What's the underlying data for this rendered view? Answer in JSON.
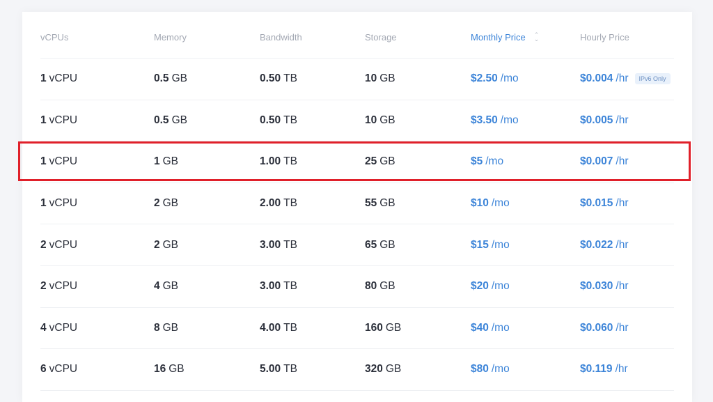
{
  "table": {
    "columns": [
      {
        "label": "vCPUs",
        "sorted": false
      },
      {
        "label": "Memory",
        "sorted": false
      },
      {
        "label": "Bandwidth",
        "sorted": false
      },
      {
        "label": "Storage",
        "sorted": false
      },
      {
        "label": "Monthly Price",
        "sorted": true,
        "sort_icon": "sort-up-down-icon"
      },
      {
        "label": "Hourly Price",
        "sorted": false
      }
    ],
    "rows": [
      {
        "vcpu": {
          "n": "1",
          "u": "vCPU"
        },
        "memory": {
          "n": "0.5",
          "u": "GB"
        },
        "bandwidth": {
          "n": "0.50",
          "u": "TB"
        },
        "storage": {
          "n": "10",
          "u": "GB"
        },
        "monthly": {
          "n": "$2.50",
          "u": "/mo"
        },
        "hourly": {
          "n": "$0.004",
          "u": "/hr"
        },
        "badge": "IPv6 Only",
        "highlighted": false
      },
      {
        "vcpu": {
          "n": "1",
          "u": "vCPU"
        },
        "memory": {
          "n": "0.5",
          "u": "GB"
        },
        "bandwidth": {
          "n": "0.50",
          "u": "TB"
        },
        "storage": {
          "n": "10",
          "u": "GB"
        },
        "monthly": {
          "n": "$3.50",
          "u": "/mo"
        },
        "hourly": {
          "n": "$0.005",
          "u": "/hr"
        },
        "badge": null,
        "highlighted": false
      },
      {
        "vcpu": {
          "n": "1",
          "u": "vCPU"
        },
        "memory": {
          "n": "1",
          "u": "GB"
        },
        "bandwidth": {
          "n": "1.00",
          "u": "TB"
        },
        "storage": {
          "n": "25",
          "u": "GB"
        },
        "monthly": {
          "n": "$5",
          "u": "/mo"
        },
        "hourly": {
          "n": "$0.007",
          "u": "/hr"
        },
        "badge": null,
        "highlighted": true
      },
      {
        "vcpu": {
          "n": "1",
          "u": "vCPU"
        },
        "memory": {
          "n": "2",
          "u": "GB"
        },
        "bandwidth": {
          "n": "2.00",
          "u": "TB"
        },
        "storage": {
          "n": "55",
          "u": "GB"
        },
        "monthly": {
          "n": "$10",
          "u": "/mo"
        },
        "hourly": {
          "n": "$0.015",
          "u": "/hr"
        },
        "badge": null,
        "highlighted": false
      },
      {
        "vcpu": {
          "n": "2",
          "u": "vCPU"
        },
        "memory": {
          "n": "2",
          "u": "GB"
        },
        "bandwidth": {
          "n": "3.00",
          "u": "TB"
        },
        "storage": {
          "n": "65",
          "u": "GB"
        },
        "monthly": {
          "n": "$15",
          "u": "/mo"
        },
        "hourly": {
          "n": "$0.022",
          "u": "/hr"
        },
        "badge": null,
        "highlighted": false
      },
      {
        "vcpu": {
          "n": "2",
          "u": "vCPU"
        },
        "memory": {
          "n": "4",
          "u": "GB"
        },
        "bandwidth": {
          "n": "3.00",
          "u": "TB"
        },
        "storage": {
          "n": "80",
          "u": "GB"
        },
        "monthly": {
          "n": "$20",
          "u": "/mo"
        },
        "hourly": {
          "n": "$0.030",
          "u": "/hr"
        },
        "badge": null,
        "highlighted": false
      },
      {
        "vcpu": {
          "n": "4",
          "u": "vCPU"
        },
        "memory": {
          "n": "8",
          "u": "GB"
        },
        "bandwidth": {
          "n": "4.00",
          "u": "TB"
        },
        "storage": {
          "n": "160",
          "u": "GB"
        },
        "monthly": {
          "n": "$40",
          "u": "/mo"
        },
        "hourly": {
          "n": "$0.060",
          "u": "/hr"
        },
        "badge": null,
        "highlighted": false
      },
      {
        "vcpu": {
          "n": "6",
          "u": "vCPU"
        },
        "memory": {
          "n": "16",
          "u": "GB"
        },
        "bandwidth": {
          "n": "5.00",
          "u": "TB"
        },
        "storage": {
          "n": "320",
          "u": "GB"
        },
        "monthly": {
          "n": "$80",
          "u": "/mo"
        },
        "hourly": {
          "n": "$0.119",
          "u": "/hr"
        },
        "badge": null,
        "highlighted": false
      }
    ]
  },
  "colors": {
    "accent": "#3c84d8",
    "highlight_border": "#e0202a",
    "badge_bg": "#e9f1fb",
    "header_text": "#a3a8b3",
    "body_text": "#2b2f3a"
  }
}
